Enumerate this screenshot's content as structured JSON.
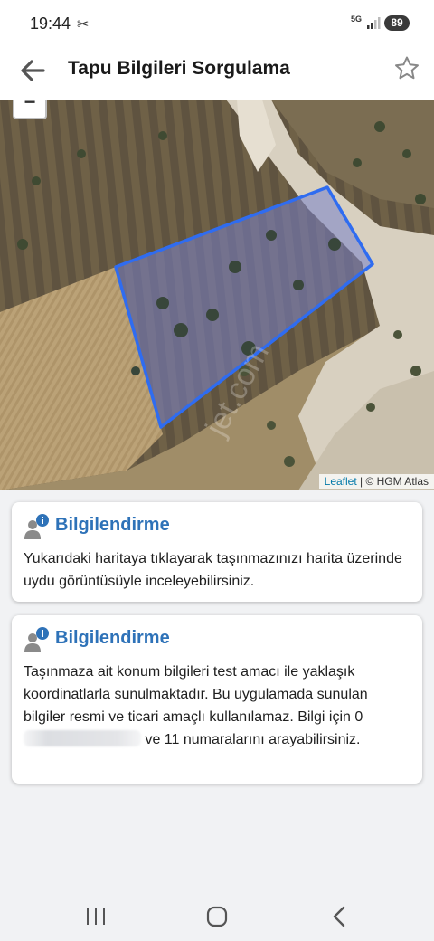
{
  "status_bar": {
    "time": "19:44",
    "notification_glyph": "✂",
    "network": "5G",
    "battery": "89"
  },
  "app_bar": {
    "title": "Tapu Bilgileri Sorgulama",
    "back_icon": "arrow-left-icon",
    "favorite_icon": "star-outline-icon"
  },
  "map": {
    "zoom_out_label": "−",
    "attribution_link": "Leaflet",
    "attribution_sep": " | © ",
    "attribution_source": "HGM Atlas",
    "watermark": "jet.com",
    "parcel_outline_color": "#2f6cf0"
  },
  "cards": [
    {
      "title": "Bilgilendirme",
      "icon": "user-info-icon",
      "text": "Yukarıdaki haritaya tıklayarak taşınmazınızı harita üzerinde uydu görüntüsüyle inceleyebilirsiniz."
    },
    {
      "title": "Bilgilendirme",
      "icon": "user-info-icon",
      "text_before": "Taşınmaza ait konum bilgileri test amacı ile yaklaşık koordinatlarla sunulmaktadır. Bu uygulamada sunulan bilgiler resmi ve ticari amaçlı kullanılamaz. Bilgi için 0",
      "text_after": "ve 11 numaralarını arayabilirsiniz."
    }
  ],
  "colors": {
    "accent": "#2e72b8",
    "background": "#f1f2f4"
  },
  "nav_bar": {
    "recent_icon": "recent-apps-icon",
    "home_icon": "home-icon",
    "back_icon": "nav-back-icon"
  }
}
